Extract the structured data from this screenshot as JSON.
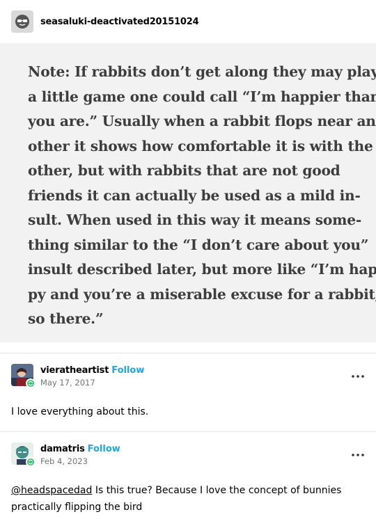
{
  "post": {
    "username": "seasaluki-deactivated20151024",
    "quote_lines": [
      "Note: If rabbits don’t get along they may play",
      "a little game one could call “I’m happier than",
      "you are.” Usually when a rabbit flops near an-",
      "other it shows how comfortable it is with the",
      "other, but with rabbits that are not good",
      "friends it can actually be used as a mild in-",
      "sult. When used in this way it means some-",
      "thing similar to the “I don’t care about you”",
      "insult described later, but more like “I’m hap-",
      "py and you’re a miserable excuse for a rabbit,",
      "so there.”"
    ]
  },
  "reblogs": [
    {
      "username": "vieratheartist",
      "follow_label": "Follow",
      "date": "May 17, 2017",
      "body": "I love everything about this."
    },
    {
      "username": "damatris",
      "follow_label": "Follow",
      "date": "Feb 4, 2023",
      "mention": "@headspacedad",
      "body_rest": " Is this true? Because I love the concept of bunnies practically flipping the bird"
    }
  ],
  "icons": {
    "avatar_op": "deactivated-avatar-icon",
    "badge": "reblog-badge-icon",
    "more": "more-options-icon"
  },
  "colors": {
    "follow": "#1ea5e6",
    "badge": "#2ec26b",
    "quote_bg": "#f2f2f2"
  }
}
